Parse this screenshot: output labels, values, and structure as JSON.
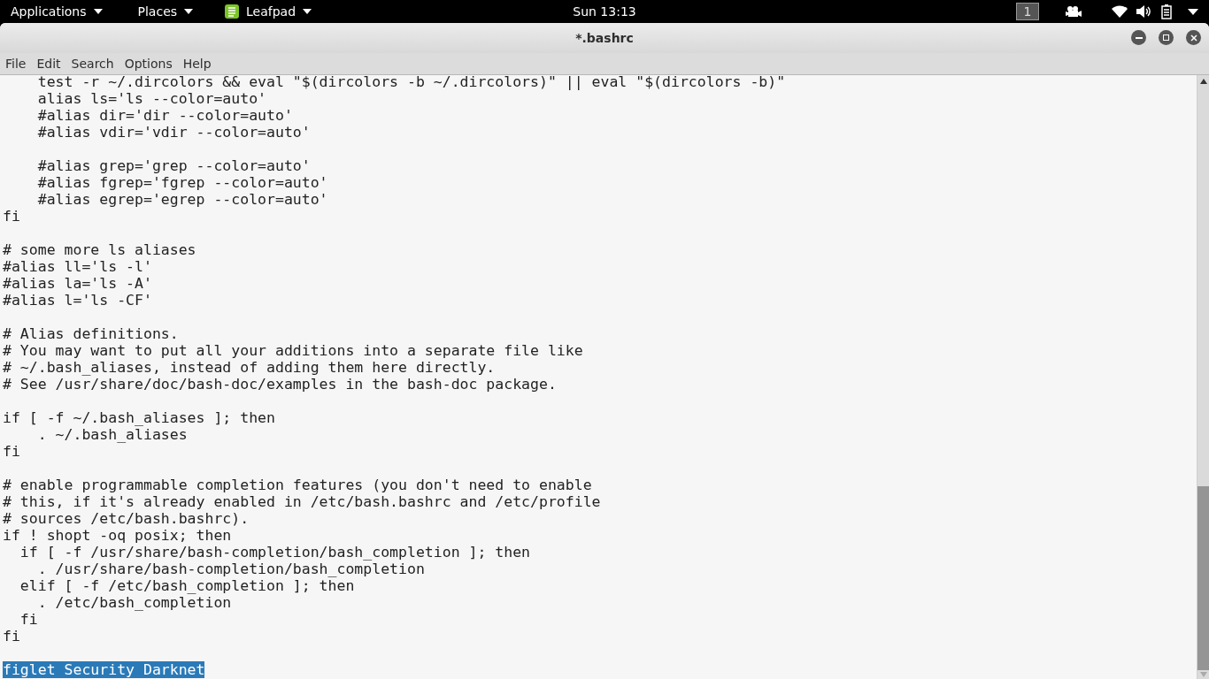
{
  "top_bar": {
    "menus": [
      {
        "label": "Applications"
      },
      {
        "label": "Places"
      },
      {
        "label": "Leafpad"
      }
    ],
    "clock": "Sun 13:13",
    "workspace": "1"
  },
  "window": {
    "title": "*.bashrc"
  },
  "menu_bar": [
    "File",
    "Edit",
    "Search",
    "Options",
    "Help"
  ],
  "editor": {
    "lines": [
      {
        "kind": "code",
        "text": "    test -r ~/.dircolors && eval \"$(dircolors -b ~/.dircolors)\" || eval \"$(dircolors -b)\"",
        "selected": false
      },
      {
        "kind": "code",
        "text": "    alias ls='ls --color=auto'",
        "selected": false
      },
      {
        "kind": "code",
        "text": "    #alias dir='dir --color=auto'",
        "selected": false
      },
      {
        "kind": "code",
        "text": "    #alias vdir='vdir --color=auto'",
        "selected": false
      },
      {
        "kind": "blank"
      },
      {
        "kind": "code",
        "text": "    #alias grep='grep --color=auto'",
        "selected": false
      },
      {
        "kind": "code",
        "text": "    #alias fgrep='fgrep --color=auto'",
        "selected": false
      },
      {
        "kind": "code",
        "text": "    #alias egrep='egrep --color=auto'",
        "selected": false
      },
      {
        "kind": "code",
        "text": "fi",
        "selected": false
      },
      {
        "kind": "blank"
      },
      {
        "kind": "code",
        "text": "# some more ls aliases",
        "selected": false
      },
      {
        "kind": "code",
        "text": "#alias ll='ls -l'",
        "selected": false
      },
      {
        "kind": "code",
        "text": "#alias la='ls -A'",
        "selected": false
      },
      {
        "kind": "code",
        "text": "#alias l='ls -CF'",
        "selected": false
      },
      {
        "kind": "blank"
      },
      {
        "kind": "code",
        "text": "# Alias definitions.",
        "selected": false
      },
      {
        "kind": "code",
        "text": "# You may want to put all your additions into a separate file like",
        "selected": false
      },
      {
        "kind": "code",
        "text": "# ~/.bash_aliases, instead of adding them here directly.",
        "selected": false
      },
      {
        "kind": "code",
        "text": "# See /usr/share/doc/bash-doc/examples in the bash-doc package.",
        "selected": false
      },
      {
        "kind": "blank"
      },
      {
        "kind": "code",
        "text": "if [ -f ~/.bash_aliases ]; then",
        "selected": false
      },
      {
        "kind": "code",
        "text": "    . ~/.bash_aliases",
        "selected": false
      },
      {
        "kind": "code",
        "text": "fi",
        "selected": false
      },
      {
        "kind": "blank"
      },
      {
        "kind": "code",
        "text": "# enable programmable completion features (you don't need to enable",
        "selected": false
      },
      {
        "kind": "code",
        "text": "# this, if it's already enabled in /etc/bash.bashrc and /etc/profile",
        "selected": false
      },
      {
        "kind": "code",
        "text": "# sources /etc/bash.bashrc).",
        "selected": false
      },
      {
        "kind": "code",
        "text": "if ! shopt -oq posix; then",
        "selected": false
      },
      {
        "kind": "code",
        "text": "  if [ -f /usr/share/bash-completion/bash_completion ]; then",
        "selected": false
      },
      {
        "kind": "code",
        "text": "    . /usr/share/bash-completion/bash_completion",
        "selected": false
      },
      {
        "kind": "code",
        "text": "  elif [ -f /etc/bash_completion ]; then",
        "selected": false
      },
      {
        "kind": "code",
        "text": "    . /etc/bash_completion",
        "selected": false
      },
      {
        "kind": "code",
        "text": "  fi",
        "selected": false
      },
      {
        "kind": "code",
        "text": "fi",
        "selected": false
      },
      {
        "kind": "blank"
      },
      {
        "kind": "code",
        "text": "figlet Security Darknet",
        "selected": true
      }
    ]
  }
}
